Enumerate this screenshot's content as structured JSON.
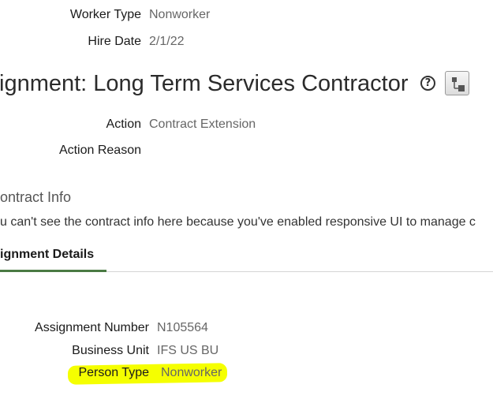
{
  "top_fields": {
    "worker_type": {
      "label": "Worker Type",
      "value": "Nonworker"
    },
    "hire_date": {
      "label": "Hire Date",
      "value": "2/1/22"
    }
  },
  "assignment_title": "ignment: Long Term Services Contractor",
  "icons": {
    "help": "help-circle-icon",
    "structure": "org-structure-icon"
  },
  "action_fields": {
    "action": {
      "label": "Action",
      "value": "Contract Extension"
    },
    "action_reason": {
      "label": "Action Reason",
      "value": ""
    }
  },
  "contract_info": {
    "heading": "ontract Info",
    "message": "u can't see the contract info here because you've enabled responsive UI to manage c"
  },
  "tabs": [
    {
      "label": "ignment Details",
      "selected": true
    }
  ],
  "details": {
    "assignment_number": {
      "label": "Assignment Number",
      "value": "N105564"
    },
    "business_unit": {
      "label": "Business Unit",
      "value": "IFS US BU"
    },
    "person_type": {
      "label": "Person Type",
      "value": "Nonworker"
    }
  },
  "colors": {
    "highlight": "#f5ff00",
    "tab_accent": "#4a7a43"
  }
}
